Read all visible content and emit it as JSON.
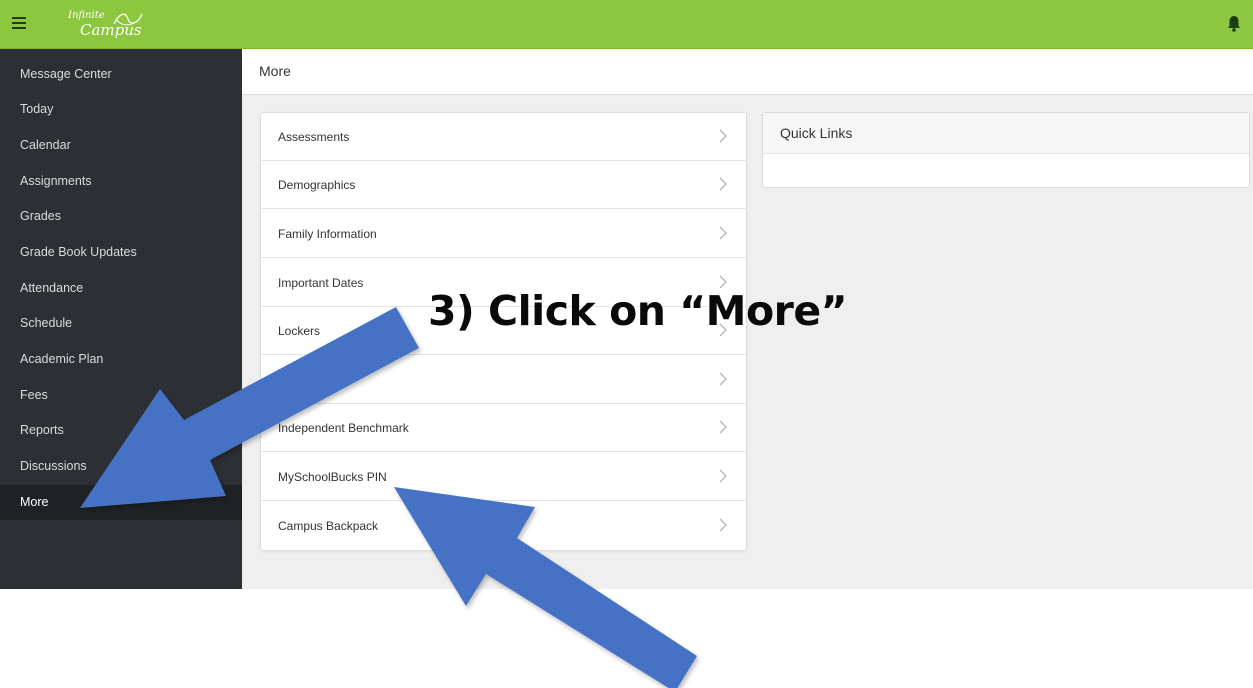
{
  "header": {
    "menu_icon": "hamburger-icon",
    "logo_line1": "Infinite",
    "logo_line2": "Campus",
    "bell_icon": "bell-icon",
    "accent": "#8dc63f"
  },
  "sidebar": {
    "items": [
      {
        "label": "Message Center"
      },
      {
        "label": "Today"
      },
      {
        "label": "Calendar"
      },
      {
        "label": "Assignments"
      },
      {
        "label": "Grades"
      },
      {
        "label": "Grade Book Updates"
      },
      {
        "label": "Attendance"
      },
      {
        "label": "Schedule"
      },
      {
        "label": "Academic Plan"
      },
      {
        "label": "Fees"
      },
      {
        "label": "Reports"
      },
      {
        "label": "Discussions"
      },
      {
        "label": "More"
      }
    ],
    "active": "More"
  },
  "main": {
    "title": "More",
    "list": [
      {
        "label": "Assessments"
      },
      {
        "label": "Demographics"
      },
      {
        "label": "Family Information"
      },
      {
        "label": "Important Dates"
      },
      {
        "label": "Lockers"
      },
      {
        "label": ""
      },
      {
        "label": "Independent Benchmark"
      },
      {
        "label": "MySchoolBucks PIN"
      },
      {
        "label": "Campus Backpack"
      }
    ],
    "quick_links_title": "Quick Links"
  },
  "annotation": {
    "text": "3) Click on “More”",
    "arrow_color": "#4472c4"
  }
}
